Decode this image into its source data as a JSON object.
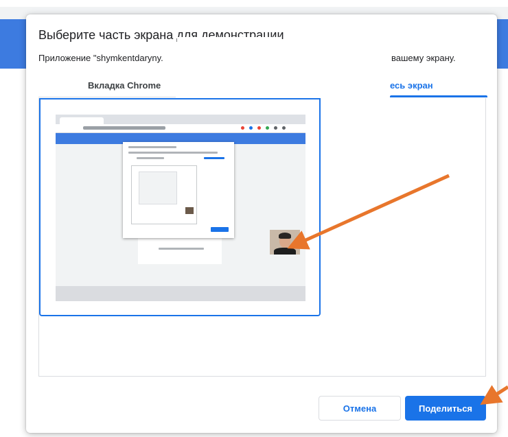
{
  "dialog": {
    "title": "Выберите часть экрана для демонстрации",
    "subtitle_left": "Приложение \"shymkentdaryny.",
    "subtitle_right": "вашему экрану.",
    "tabs": [
      {
        "label": "Вкладка Chrome"
      },
      {
        "label": "есь экран"
      }
    ],
    "cancel_label": "Отмена",
    "share_label": "Поделиться"
  },
  "colors": {
    "accent": "#1a73e8",
    "annotation_arrow": "#e8762c"
  },
  "icons": [
    "arrow-annotation-icon"
  ]
}
